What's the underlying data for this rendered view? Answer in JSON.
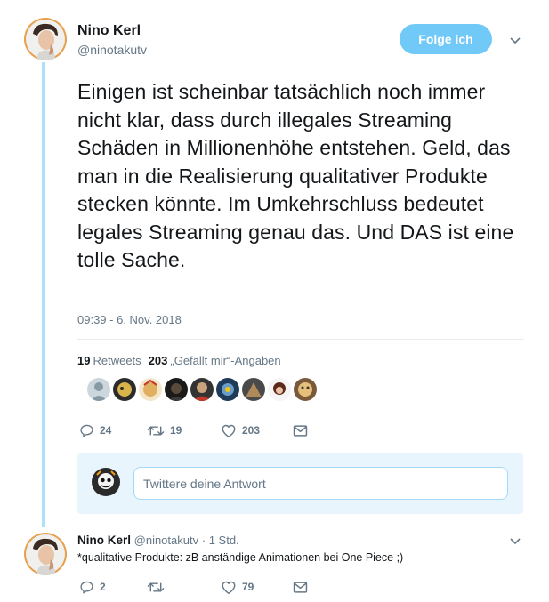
{
  "tweet": {
    "author_name": "Nino Kerl",
    "author_handle": "@ninotakutv",
    "follow_label": "Folge ich",
    "text": "Einigen ist scheinbar tatsächlich noch immer nicht klar, dass durch illegales Streaming Schäden in Millionenhöhe entstehen. Geld, das man in die Realisierung qualitativer Produkte stecken könnte. Im Umkehrschluss bedeutet legales Streaming genau das. Und DAS ist eine tolle Sache.",
    "timestamp": "09:39 - 6. Nov. 2018",
    "retweets_count": "19",
    "retweets_label": "Retweets",
    "likes_count": "203",
    "likes_label": "„Gefällt mir“-Angaben",
    "actions": {
      "reply_count": "24",
      "retweet_count": "19",
      "like_count": "203"
    }
  },
  "reply_box": {
    "placeholder": "Twittere deine Antwort"
  },
  "reply_tweet": {
    "author_name": "Nino Kerl",
    "author_handle": "@ninotakutv",
    "separator": "·",
    "time": "1 Std.",
    "text": "*qualitative Produkte: zB anständige Animationen bei One Piece ;)",
    "actions": {
      "reply_count": "2",
      "retweet_count": "",
      "like_count": "79"
    }
  },
  "icons": {
    "reply": "reply-icon",
    "retweet": "retweet-icon",
    "like": "heart-icon",
    "message": "envelope-icon",
    "menu": "chevron-down-icon"
  },
  "colors": {
    "accent": "#1da1f2",
    "follow_button": "#71c9f8",
    "thread_line": "#aee1f9",
    "muted_text": "#657786",
    "reply_box_bg": "#e8f5fd"
  }
}
